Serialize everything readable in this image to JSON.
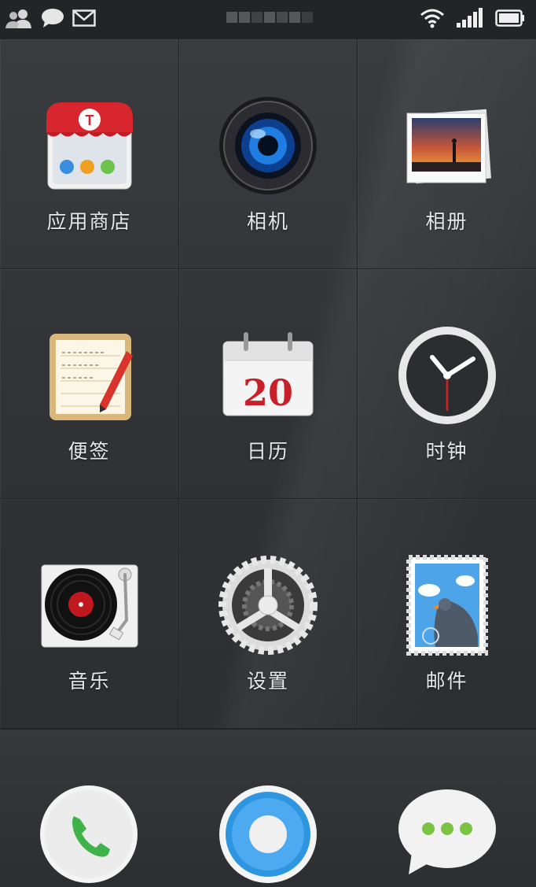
{
  "status_bar": {
    "left_icons": [
      "contacts-icon",
      "chat-bubble-icon",
      "mail-icon"
    ],
    "right_icons": [
      "wifi-icon",
      "signal-icon",
      "battery-icon"
    ]
  },
  "apps": [
    {
      "label": "应用商店",
      "icon": "app-store-icon"
    },
    {
      "label": "相机",
      "icon": "camera-icon"
    },
    {
      "label": "相册",
      "icon": "gallery-icon"
    },
    {
      "label": "便签",
      "icon": "notes-icon"
    },
    {
      "label": "日历",
      "icon": "calendar-icon",
      "calendar_day": "20"
    },
    {
      "label": "时钟",
      "icon": "clock-icon"
    },
    {
      "label": "音乐",
      "icon": "music-icon"
    },
    {
      "label": "设置",
      "icon": "settings-icon"
    },
    {
      "label": "邮件",
      "icon": "mail-stamp-icon"
    }
  ],
  "dock": [
    {
      "icon": "phone-icon"
    },
    {
      "icon": "browser-icon"
    },
    {
      "icon": "messages-icon"
    }
  ],
  "colors": {
    "background": "#2e3033",
    "label_text": "#e8e8e8",
    "calendar_red": "#c8202a",
    "phone_green": "#3fb24a",
    "browser_blue": "#2e95e0",
    "message_green": "#7cc243"
  }
}
